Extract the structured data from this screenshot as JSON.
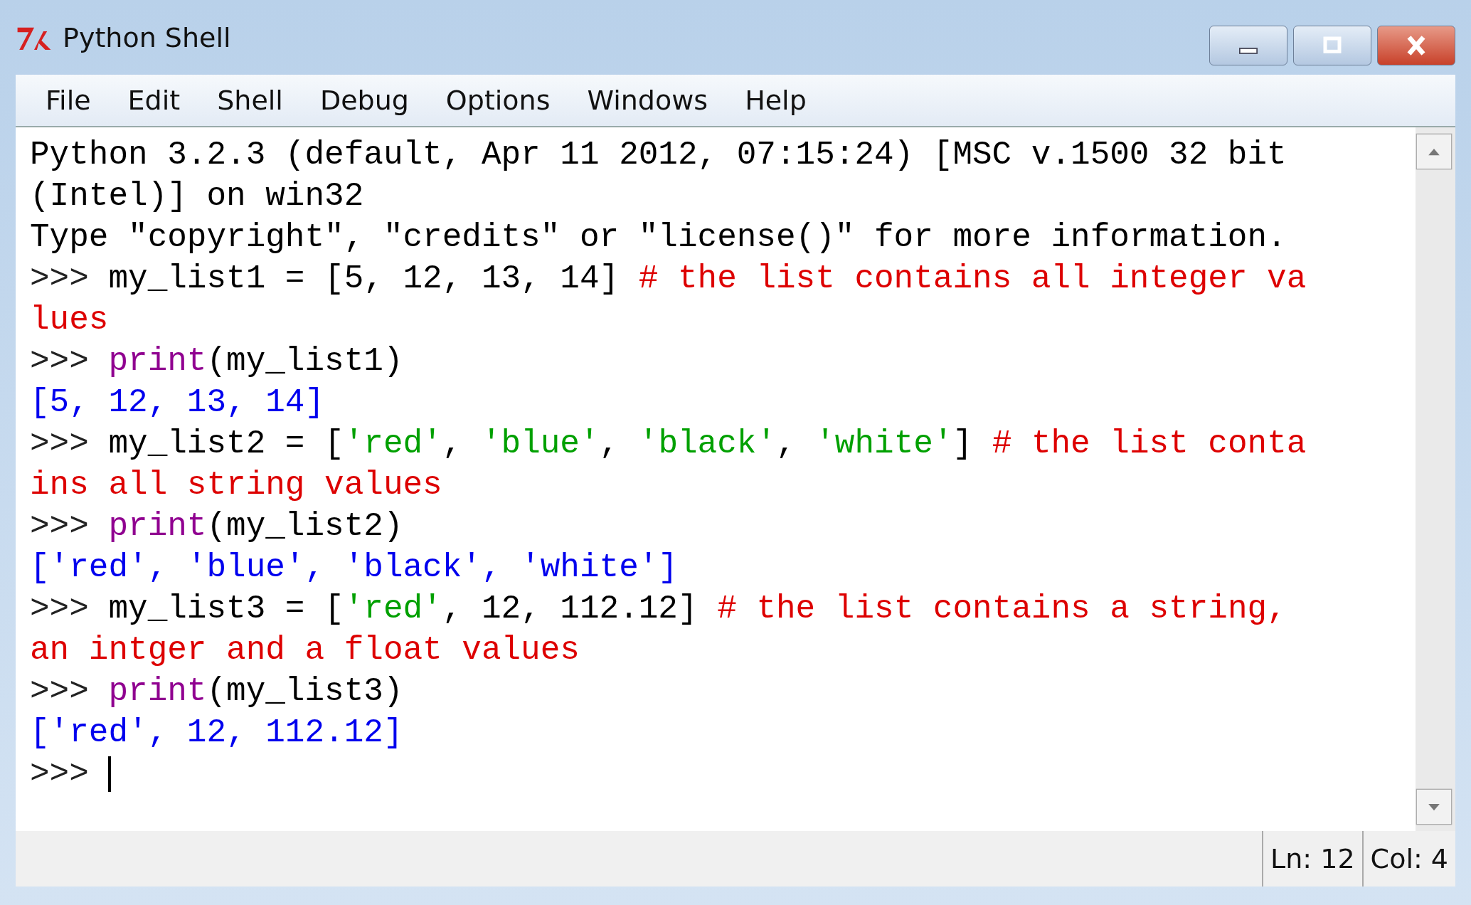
{
  "window": {
    "title": "Python Shell"
  },
  "menu": [
    "File",
    "Edit",
    "Shell",
    "Debug",
    "Options",
    "Windows",
    "Help"
  ],
  "shell_lines": [
    [
      {
        "kind": "plain",
        "text": "Python 3.2.3 (default, Apr 11 2012, 07:15:24) [MSC v.1500 32 bit"
      }
    ],
    [
      {
        "kind": "plain",
        "text": "(Intel)] on win32"
      }
    ],
    [
      {
        "kind": "plain",
        "text": "Type \"copyright\", \"credits\" or \"license()\" for more information."
      }
    ],
    [
      {
        "kind": "prompt",
        "text": ">>> "
      },
      {
        "kind": "plain",
        "text": "my_list1 = [5, 12, 13, 14] "
      },
      {
        "kind": "comment",
        "text": "# the list contains all integer va"
      }
    ],
    [
      {
        "kind": "comment",
        "text": "lues"
      }
    ],
    [
      {
        "kind": "prompt",
        "text": ">>> "
      },
      {
        "kind": "builtin",
        "text": "print"
      },
      {
        "kind": "plain",
        "text": "(my_list1)"
      }
    ],
    [
      {
        "kind": "output",
        "text": "[5, 12, 13, 14]"
      }
    ],
    [
      {
        "kind": "prompt",
        "text": ">>> "
      },
      {
        "kind": "plain",
        "text": "my_list2 = ["
      },
      {
        "kind": "string",
        "text": "'red'"
      },
      {
        "kind": "plain",
        "text": ", "
      },
      {
        "kind": "string",
        "text": "'blue'"
      },
      {
        "kind": "plain",
        "text": ", "
      },
      {
        "kind": "string",
        "text": "'black'"
      },
      {
        "kind": "plain",
        "text": ", "
      },
      {
        "kind": "string",
        "text": "'white'"
      },
      {
        "kind": "plain",
        "text": "] "
      },
      {
        "kind": "comment",
        "text": "# the list conta"
      }
    ],
    [
      {
        "kind": "comment",
        "text": "ins all string values"
      }
    ],
    [
      {
        "kind": "prompt",
        "text": ">>> "
      },
      {
        "kind": "builtin",
        "text": "print"
      },
      {
        "kind": "plain",
        "text": "(my_list2)"
      }
    ],
    [
      {
        "kind": "output",
        "text": "['red', 'blue', 'black', 'white']"
      }
    ],
    [
      {
        "kind": "prompt",
        "text": ">>> "
      },
      {
        "kind": "plain",
        "text": "my_list3 = ["
      },
      {
        "kind": "string",
        "text": "'red'"
      },
      {
        "kind": "plain",
        "text": ", 12, 112.12] "
      },
      {
        "kind": "comment",
        "text": "# the list contains a string,"
      }
    ],
    [
      {
        "kind": "comment",
        "text": "an intger and a float values"
      }
    ],
    [
      {
        "kind": "prompt",
        "text": ">>> "
      },
      {
        "kind": "builtin",
        "text": "print"
      },
      {
        "kind": "plain",
        "text": "(my_list3)"
      }
    ],
    [
      {
        "kind": "output",
        "text": "['red', 12, 112.12]"
      }
    ],
    [
      {
        "kind": "prompt",
        "text": ">>> "
      },
      {
        "kind": "cursor"
      }
    ]
  ],
  "status_bar": {
    "line": "Ln: 12",
    "column": "Col: 4"
  }
}
